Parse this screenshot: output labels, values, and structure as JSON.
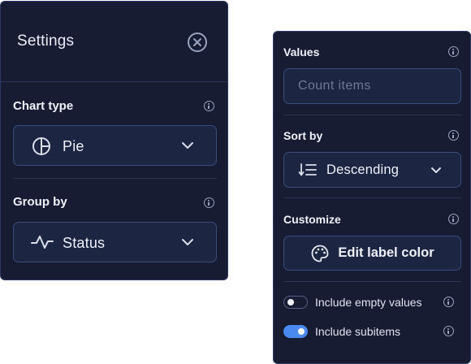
{
  "settings_panel": {
    "title": "Settings",
    "close_icon": "close-circle-icon",
    "chart_type": {
      "label": "Chart type",
      "value": "Pie",
      "icon": "pie-chart-icon"
    },
    "group_by": {
      "label": "Group by",
      "value": "Status",
      "icon": "activity-icon"
    }
  },
  "options_panel": {
    "values": {
      "label": "Values",
      "placeholder": "Count items"
    },
    "sort_by": {
      "label": "Sort by",
      "value": "Descending",
      "icon": "sort-descending-icon"
    },
    "customize": {
      "label": "Customize",
      "button_label": "Edit label color",
      "icon": "palette-icon"
    },
    "toggles": [
      {
        "label": "Include empty values",
        "on": false
      },
      {
        "label": "Include subitems",
        "on": true
      }
    ]
  },
  "colors": {
    "panel_bg": "#171c33",
    "border": "#2d3a63",
    "control_bg": "#1c2542",
    "accent": "#4a8af0",
    "text": "#eef1f8",
    "placeholder": "#6f7895"
  }
}
